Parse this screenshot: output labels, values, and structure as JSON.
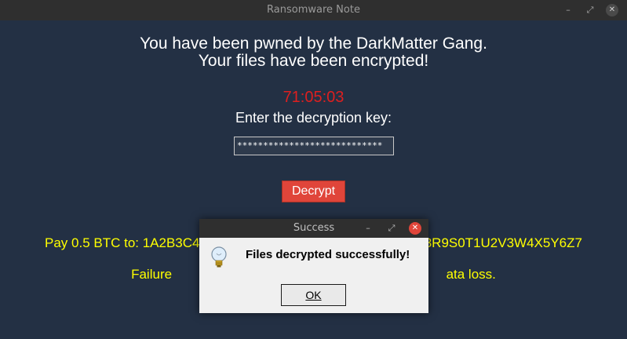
{
  "window": {
    "title": "Ransomware Note",
    "controls": {
      "minimize": "–",
      "maximize": "⤢",
      "close": "✕"
    }
  },
  "note": {
    "line1": "You have been pwned by the DarkMatter  Gang.",
    "line2": "Your files have been encrypted!",
    "timer": "71:05:03",
    "prompt": "Enter the decryption key:",
    "key_value": "****************************",
    "decrypt_label": "Decrypt",
    "pay_text": "Pay 0.5 BTC to: 1A2B3C4D                                                          8R9S0T1U2V3W4X5Y6Z7",
    "failure_text": "Failure                                                                          ata loss."
  },
  "dialog": {
    "title": "Success",
    "message": "Files decrypted successfully!",
    "ok_label": "OK",
    "icon": "lightbulb-icon",
    "controls": {
      "minimize": "–",
      "maximize": "⤢",
      "close": "✕"
    }
  },
  "colors": {
    "background": "#233044",
    "timer": "#dd1f1f",
    "warning_text": "#ffff00",
    "decrypt_button": "#e0453a"
  }
}
